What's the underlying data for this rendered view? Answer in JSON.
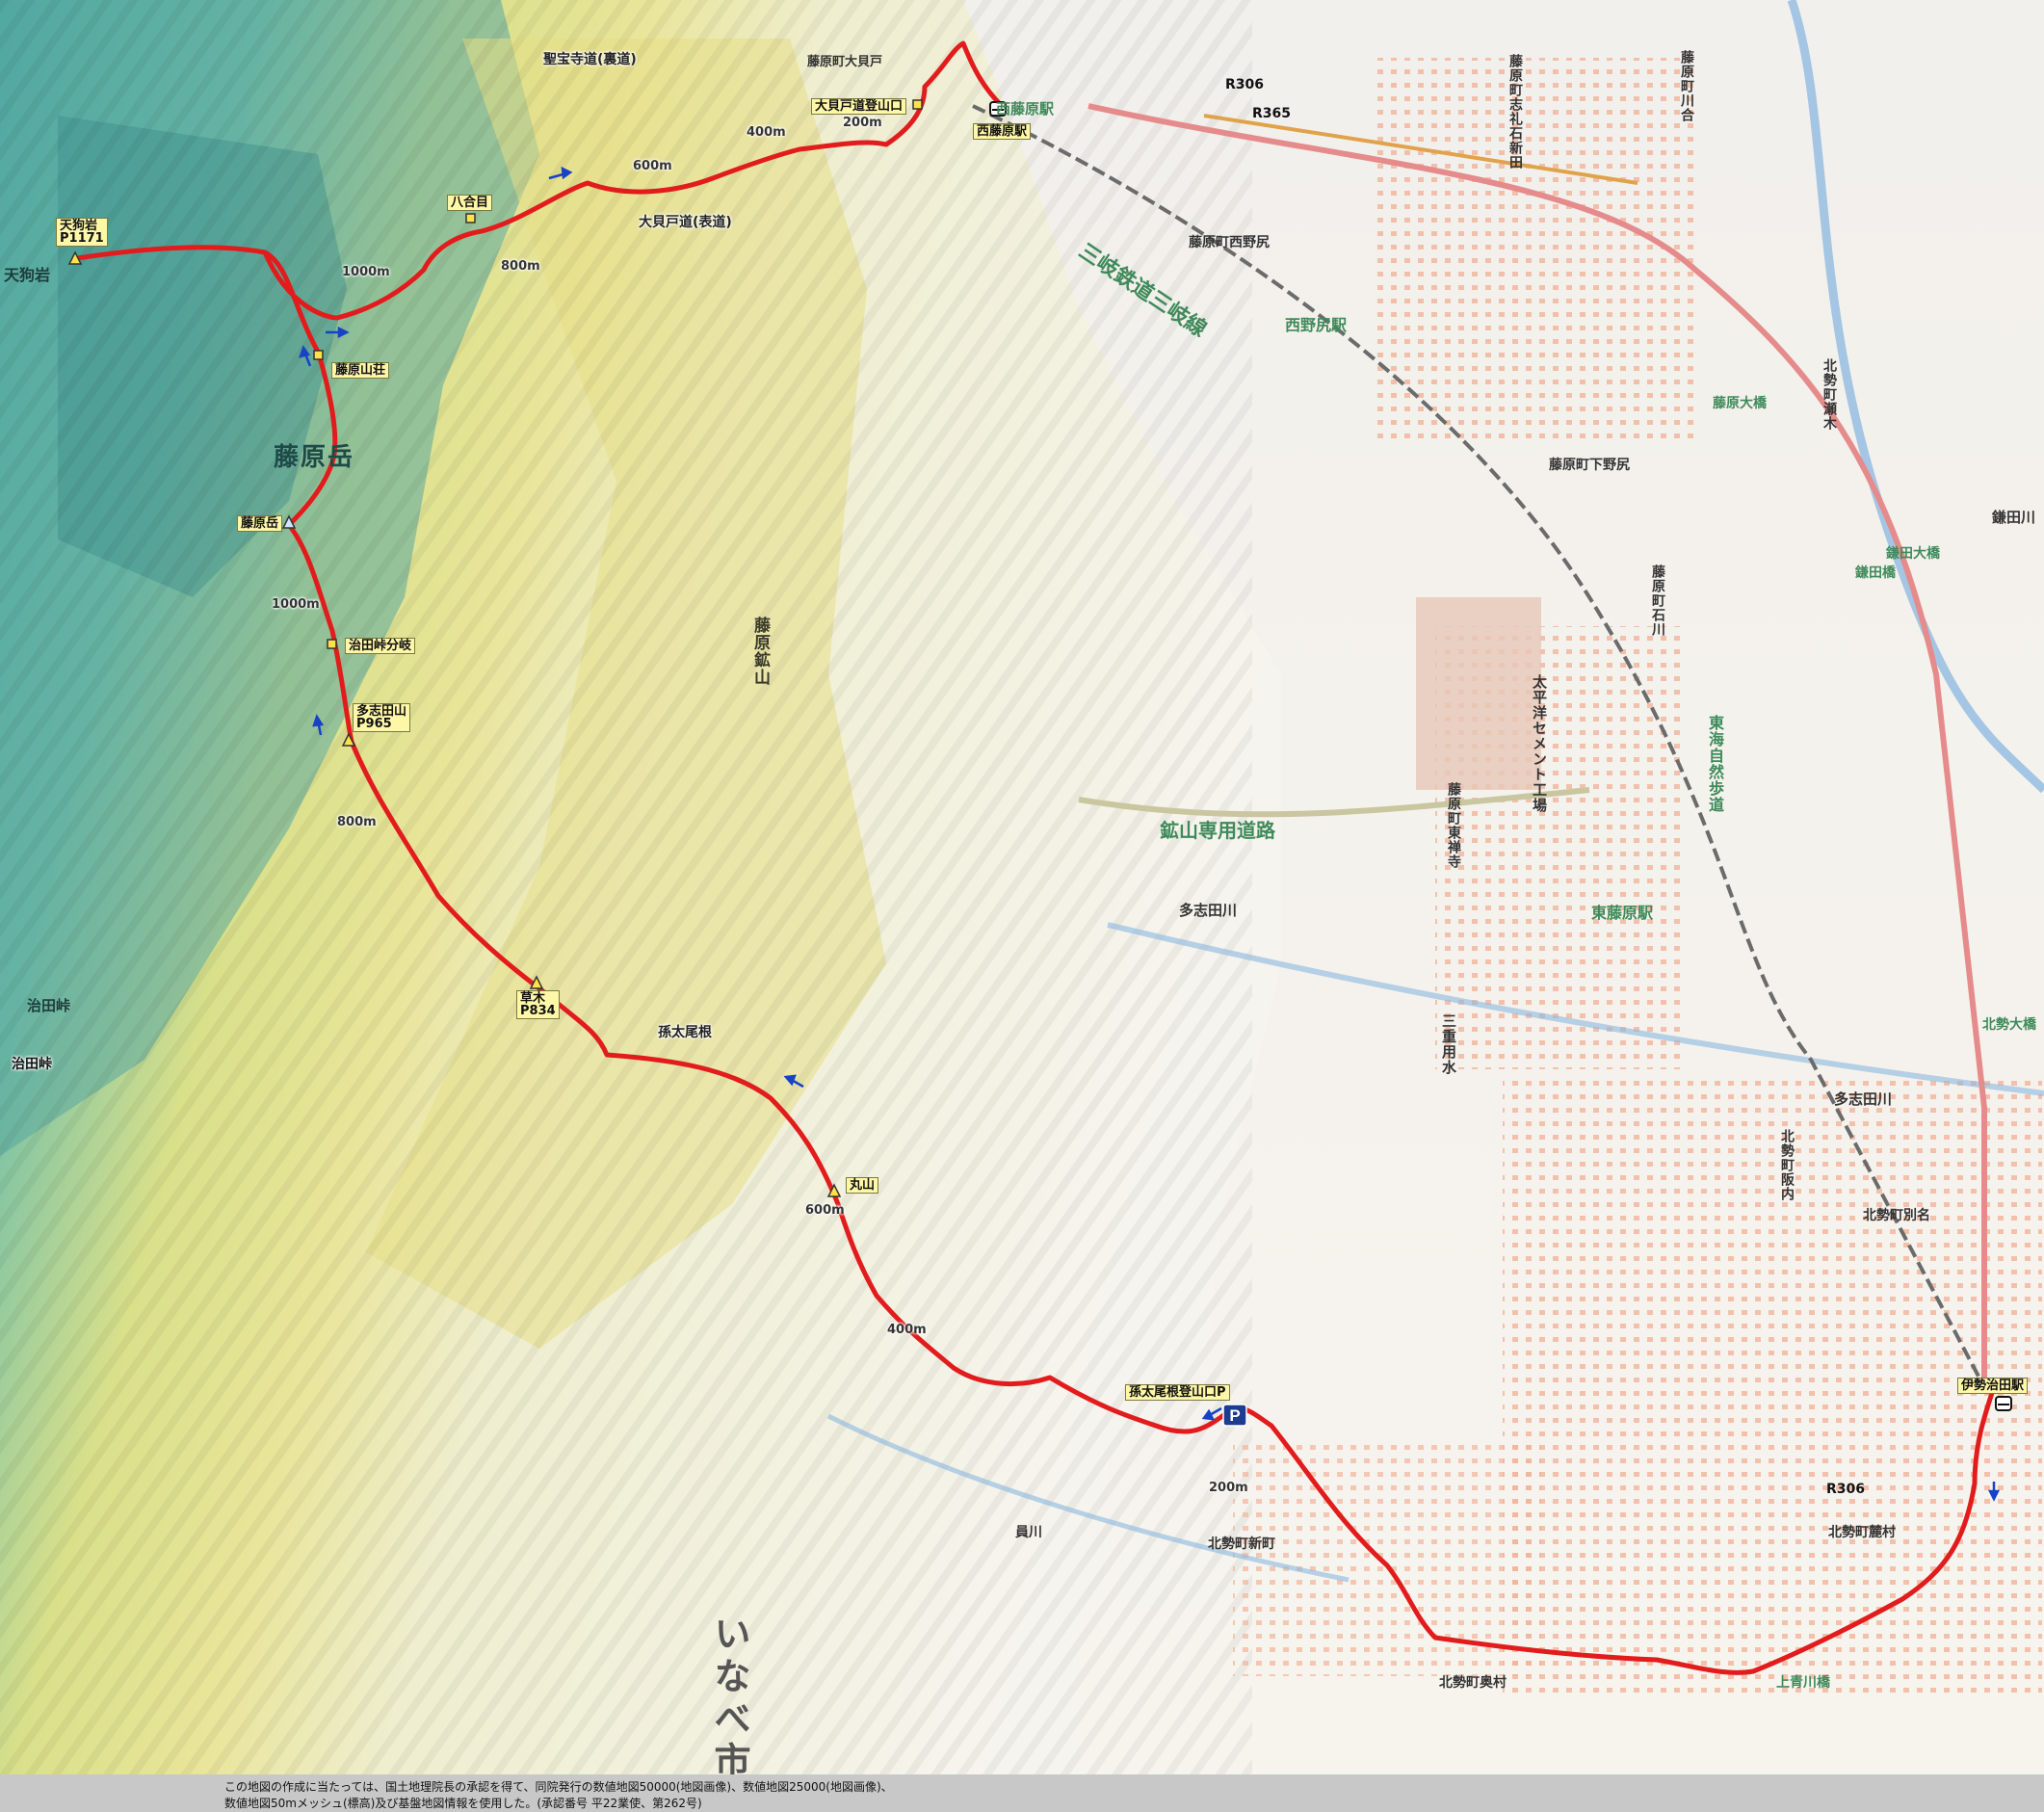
{
  "map": {
    "route_color": "#e21c1c",
    "contour_labels": [
      "200m",
      "400m",
      "600m",
      "800m",
      "1000m"
    ],
    "route_labels": {
      "lbl_1000_top": "1000m",
      "lbl_800_top": "800m",
      "lbl_600_top": "600m",
      "lbl_400_top": "400m",
      "lbl_200_top": "200m",
      "lbl_1000_mid": "1000m",
      "lbl_800_mid": "800m",
      "lbl_600_low": "600m",
      "lbl_400_low": "400m",
      "lbl_200_low": "200m"
    },
    "waypoints": {
      "tenguiwa": "天狗岩\nP1171",
      "hachigome": "八合目",
      "fujiwara_sanso": "藤原山荘",
      "fujiwaradake": "藤原岳",
      "haruta_junction": "治田峠分岐",
      "tashidayama": "多志田山\nP965",
      "kusagi": "草木\nP834",
      "maruyama": "丸山",
      "trailhead_okaido": "大貝戸道登山口",
      "trailhead_magota": "孫太尾根登山口P",
      "nishifujiwara_sta": "西藤原駅",
      "ise_haruta_sta": "伊勢治田駅"
    },
    "map_labels": {
      "shohoji_trail": "聖宝寺道(裏道)",
      "okaido_trail": "大貝戸道(表道)",
      "magota_ridge": "孫太尾根",
      "tenguiwa_area": "天狗岩",
      "fujiwaradake_big": "藤原岳",
      "haruta_pass_area": "治田峠",
      "haruta_pass": "治田峠",
      "kome_river": "員川",
      "hokusei_shinmachi": "北勢町新町",
      "hokusei_okumura": "北勢町奥村",
      "hokusei_fumotomura": "北勢町麓村",
      "hokusei_betsumyo": "北勢町別名",
      "hokusei_sakauchi": "北勢町阪内",
      "kamiaokawa_bridge": "上青川橋",
      "fujiwara_okaido": "藤原町大貝戸",
      "fujiwara_nishinoshiri": "藤原町西野尻",
      "fujiwara_shimonoshiri": "藤原町下野尻",
      "fujiwara_ishikawa": "藤原町石川",
      "fujiwara_higashizenji": "藤原町東禅寺",
      "fujiwara_shiraishi": "藤原町志礼石新田",
      "fujiwara_kawai": "藤原町川合",
      "hokusei_seki": "北勢町瀬木",
      "kamata_river": "鎌田川",
      "kamata_bridge": "鎌田大橋",
      "kamata_bridge2": "鎌田橋",
      "fujiwara_bridge": "藤原大橋",
      "hokusei_bridge": "北勢大橋",
      "tashida_river": "多志田川",
      "tashida_river2": "多志田川",
      "mine_road": "鉱山専用道路",
      "sangi_line": "三岐鉄道三岐線",
      "nishinoshiri_sta": "西野尻駅",
      "higashifujiwara_sta": "東藤原駅",
      "nishifujiwara_sta_map": "西藤原駅",
      "taiheiyo_cement": "太平洋セメント工場",
      "fujiwara_mine": "藤原鉱山",
      "tokai_trail": "東海自然歩道",
      "sanryo_water": "三重用水",
      "inabe_city": "いなべ市",
      "r306_a": "R306",
      "r365": "R365",
      "r306_b": "R306"
    }
  },
  "credit": {
    "line1": "この地図の作成に当たっては、国土地理院長の承認を得て、同院発行の数値地図50000(地図画像)、数値地図25000(地図画像)、",
    "line2": "数値地図50mメッシュ(標高)及び基盤地図情報を使用した。(承認番号 平22業使、第262号)"
  }
}
